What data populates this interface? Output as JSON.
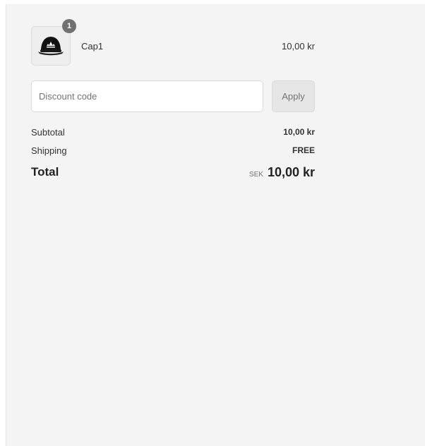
{
  "line_item": {
    "quantity": "1",
    "name": "Cap1",
    "price": "10,00 kr",
    "image_icon": "cap-icon"
  },
  "discount": {
    "placeholder": "Discount code",
    "value": "",
    "apply_label": "Apply"
  },
  "summary": {
    "subtotal_label": "Subtotal",
    "subtotal_value": "10,00 kr",
    "shipping_label": "Shipping",
    "shipping_value": "FREE",
    "total_label": "Total",
    "currency": "SEK",
    "total_value": "10,00 kr"
  },
  "colors": {
    "panel_background": "#f4f4f4",
    "badge": "#717171",
    "button_background": "#e6e6e6"
  }
}
